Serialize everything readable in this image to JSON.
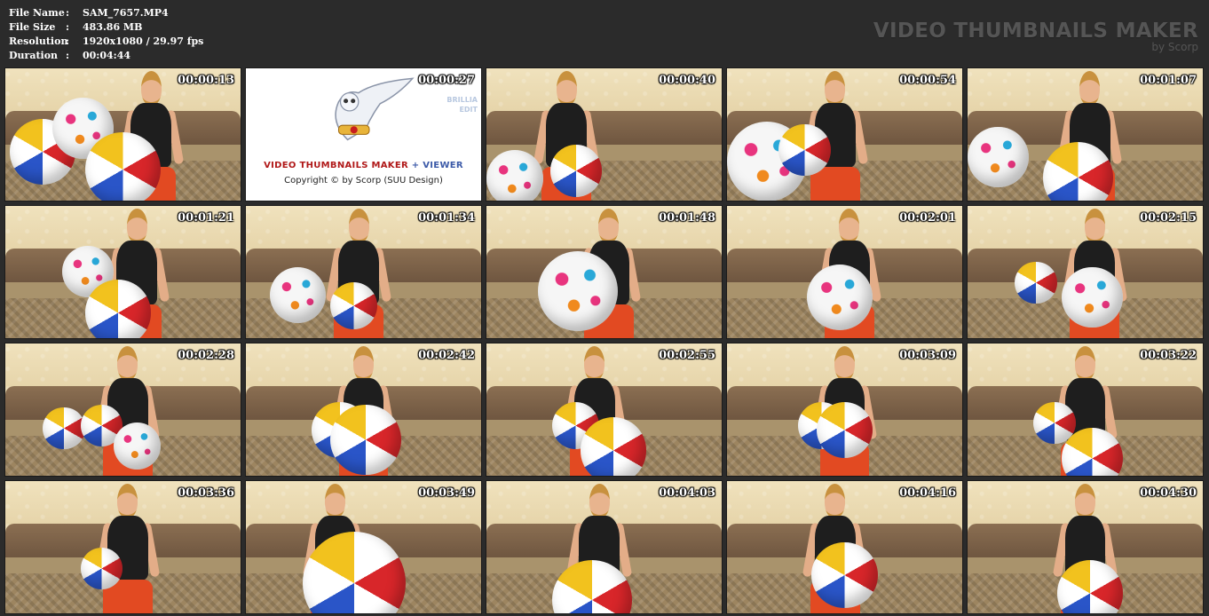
{
  "file_info": [
    {
      "label": "File Name",
      "value": "SAM_7657.MP4"
    },
    {
      "label": "File Size",
      "value": "483.86 MB"
    },
    {
      "label": "Resolution",
      "value": "1920x1080 / 29.97 fps"
    },
    {
      "label": "Duration",
      "value": "00:04:44"
    }
  ],
  "separator": ":",
  "brand": {
    "title": "VIDEO THUMBNAILS MAKER",
    "subtitle": "by Scorp"
  },
  "logo": {
    "name_part1": "VIDEO THUMBNAILS MAKER",
    "name_join": " + ",
    "name_part2": "VIEWER",
    "copyright": "Copyright © by Scorp (SUU Design)",
    "side_line1": "BRILLIA",
    "side_line2": "EDIT"
  },
  "thumbnails": [
    {
      "time": "00:00:13"
    },
    {
      "time": "00:00:27"
    },
    {
      "time": "00:00:40"
    },
    {
      "time": "00:00:54"
    },
    {
      "time": "00:01:07"
    },
    {
      "time": "00:01:21"
    },
    {
      "time": "00:01:34"
    },
    {
      "time": "00:01:48"
    },
    {
      "time": "00:02:01"
    },
    {
      "time": "00:02:15"
    },
    {
      "time": "00:02:28"
    },
    {
      "time": "00:02:42"
    },
    {
      "time": "00:02:55"
    },
    {
      "time": "00:03:09"
    },
    {
      "time": "00:03:22"
    },
    {
      "time": "00:03:36"
    },
    {
      "time": "00:03:49"
    },
    {
      "time": "00:04:03"
    },
    {
      "time": "00:04:16"
    },
    {
      "time": "00:04:30"
    }
  ]
}
